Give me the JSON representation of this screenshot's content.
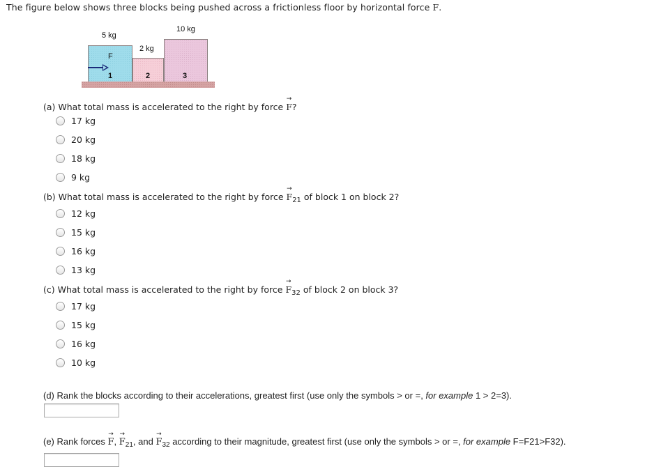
{
  "intro": {
    "text": "The figure below shows three blocks being pushed across a frictionless floor by horizontal force ",
    "force_symbol": "F",
    "end": "."
  },
  "figure": {
    "blocks": [
      {
        "number": "1",
        "mass_label": "5 kg",
        "color": "#9fdceb"
      },
      {
        "number": "2",
        "mass_label": "2 kg",
        "color": "#f6cfd8"
      },
      {
        "number": "3",
        "mass_label": "10 kg",
        "color": "#ebc7dd"
      }
    ],
    "force_label": "F",
    "arrow_color": "#1b2a7a",
    "floor_color": "#d5a3a3"
  },
  "questions": {
    "a": {
      "prefix": "(a) What total mass is accelerated to the right by force ",
      "symbol": "F",
      "subscript": "",
      "suffix": "?",
      "options": [
        "17 kg",
        "20 kg",
        "18 kg",
        "9 kg"
      ]
    },
    "b": {
      "prefix": "(b) What total mass is accelerated to the right by force ",
      "symbol": "F",
      "subscript": "21",
      "suffix": " of block 1 on block 2?",
      "options": [
        "12 kg",
        "15 kg",
        "16 kg",
        "13 kg"
      ]
    },
    "c": {
      "prefix": "(c) What total mass is accelerated to the right by force ",
      "symbol": "F",
      "subscript": "32",
      "suffix": " of block 2 on block 3?",
      "options": [
        "17 kg",
        "15 kg",
        "16 kg",
        "10 kg"
      ]
    },
    "d": {
      "text": "(d) Rank the blocks according to their accelerations, greatest first (use only the symbols > or =, ",
      "example_label": "for example",
      "example": " 1 > 2=3).",
      "input_value": ""
    },
    "e": {
      "prefix": "(e) Rank forces ",
      "f": "F",
      "sep1": ", ",
      "f21": "F",
      "sub21": "21",
      "sep2": ", and ",
      "f32": "F",
      "sub32": "32",
      "text": " according to their magnitude, greatest first (use only the symbols > or =, ",
      "example_label": "for example",
      "example": " F=F21>F32).",
      "input_value": ""
    }
  }
}
